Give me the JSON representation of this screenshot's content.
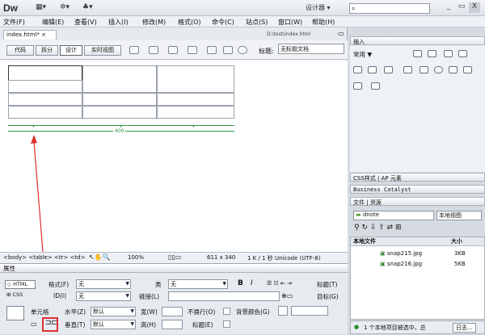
{
  "app": {
    "logo": "Dw",
    "workspace": "设计器 ▾",
    "min": "_",
    "restore": "▭",
    "close": "X"
  },
  "menu": [
    "文件(F)",
    "编辑(E)",
    "查看(V)",
    "插入(I)",
    "修改(M)",
    "格式(O)",
    "命令(C)",
    "站点(S)",
    "窗口(W)",
    "帮助(H)"
  ],
  "doc": {
    "tab": "index.html*",
    "close": "×",
    "path": "D:\\test\\index.html"
  },
  "views": [
    "代码",
    "拆分",
    "设计",
    "实时视图"
  ],
  "title_label": "标题:",
  "title_value": "无标题文档",
  "table_width": "400",
  "status": {
    "tags": "<body> <table> <tr> <td>",
    "zoom": "100%",
    "size": "611 x 340",
    "info": "1 K / 1 秒 Unicode (UTF-8)"
  },
  "props": {
    "header": "属性",
    "html": "HTML",
    "css": "CSS",
    "format_label": "格式(F)",
    "format_value": "无",
    "id_label": "ID(I)",
    "id_value": "无",
    "class_label": "类",
    "class_value": "无",
    "link_label": "链接(L)",
    "bold": "B",
    "italic": "I",
    "title_label": "标题(T)",
    "target_label": "目标(G)",
    "cell_label": "单元格",
    "h_label": "水平(Z)",
    "h_value": "默认",
    "v_label": "垂直(T)",
    "v_value": "默认",
    "w_label": "宽(W)",
    "ht_label": "高(H)",
    "nowrap_label": "不换行(O)",
    "header_label": "标题(E)",
    "bg_label": "背景颜色(G)"
  },
  "right": {
    "insert_header": "插入",
    "common": "常用",
    "css_tabs": "CSS样式",
    "ap_tab": "AP 元素",
    "bc": "Business Catalyst",
    "files_tab": "文件",
    "assets_tab": "资源",
    "site": "dnote",
    "view": "本地视图",
    "col_local": "本地文件",
    "col_size": "大小",
    "files": [
      {
        "name": "snap215.jpg",
        "size": "3KB"
      },
      {
        "name": "snap216.jpg",
        "size": "5KB"
      }
    ],
    "footer": "1 个本地项目被选中，总",
    "log": "日志..."
  }
}
